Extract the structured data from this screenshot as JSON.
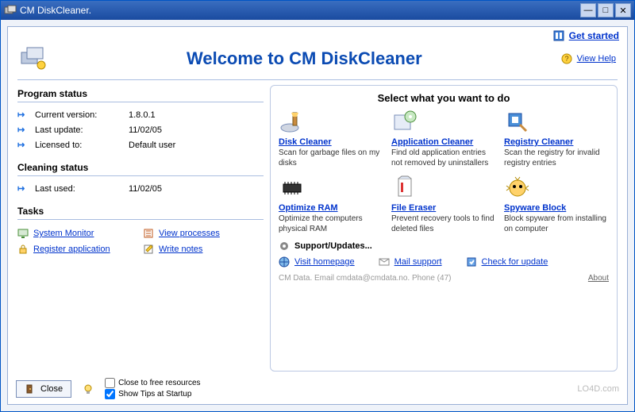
{
  "window": {
    "title": "CM DiskCleaner."
  },
  "links": {
    "get_started": "Get started",
    "view_help": "View Help"
  },
  "header": {
    "title": "Welcome to CM DiskCleaner"
  },
  "left": {
    "program_status_head": "Program status",
    "rows": {
      "version_label": "Current version:",
      "version_value": "1.8.0.1",
      "lastupdate_label": "Last update:",
      "lastupdate_value": "11/02/05",
      "licensed_label": "Licensed to:",
      "licensed_value": "Default user"
    },
    "cleaning_head": "Cleaning status",
    "lastused_label": "Last used:",
    "lastused_value": "11/02/05",
    "tasks_head": "Tasks",
    "tasks": {
      "sysmon": "System Monitor",
      "viewproc": "View processes",
      "register": "Register application",
      "notes": "Write notes"
    }
  },
  "right": {
    "select_head": "Select what you want to do",
    "cells": {
      "disk": {
        "title": "Disk Cleaner",
        "desc": "Scan for garbage files on my disks"
      },
      "app": {
        "title": "Application Cleaner",
        "desc": "Find old application entries not removed by uninstallers"
      },
      "reg": {
        "title": "Registry Cleaner",
        "desc": "Scan the registry for invalid registry entries"
      },
      "ram": {
        "title": "Optimize RAM",
        "desc": "Optimize the computers physical RAM"
      },
      "eraser": {
        "title": "File Eraser",
        "desc": "Prevent recovery tools to find deleted files"
      },
      "spy": {
        "title": "Spyware Block",
        "desc": "Block spyware from installing on computer"
      }
    },
    "support_head": "Support/Updates...",
    "support": {
      "home": "Visit homepage",
      "mail": "Mail support",
      "update": "Check for update"
    },
    "footer_info": "CM Data.  Email cmdata@cmdata.no.   Phone (47)",
    "about": "About"
  },
  "bottom": {
    "close": "Close",
    "close_free": "Close to free resources",
    "show_tips": "Show Tips at Startup"
  },
  "watermark": "LO4D.com"
}
